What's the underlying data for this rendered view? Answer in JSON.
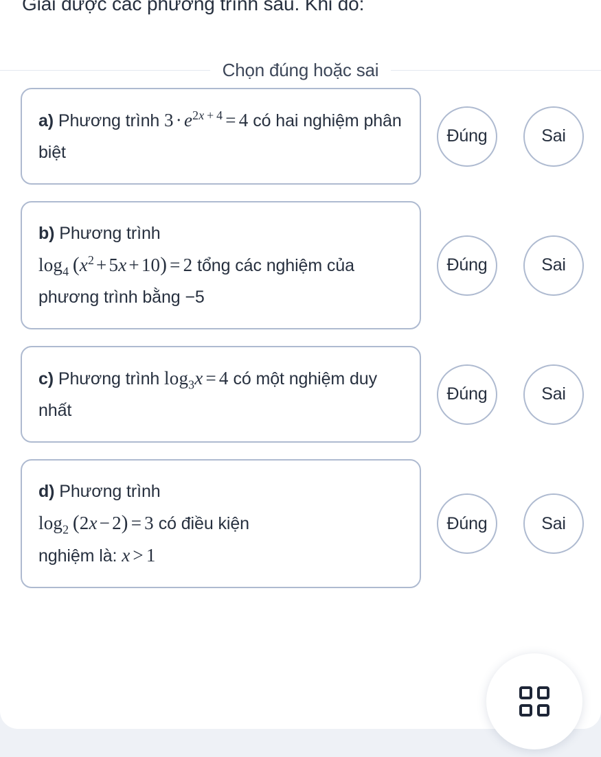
{
  "prompt": "Giải được các phương trình sau. Khi đó:",
  "section": {
    "label": "Chọn đúng hoặc sai"
  },
  "choices": {
    "true_label": "Đúng",
    "false_label": "Sai"
  },
  "questions": [
    {
      "marker": "a)",
      "lead": "Phương trình",
      "math": "3 · e^(2x + 4) = 4",
      "tail": "có hai nghiệm phân biệt",
      "full_text": "a) Phương trình 3 · e^(2x+4) = 4 có hai nghiệm phân biệt"
    },
    {
      "marker": "b)",
      "lead": "Phương trình",
      "math": "log_4 (x^2 + 5x + 10) = 2",
      "tail": "tổng các nghiệm của phương trình bằng −5",
      "full_text": "b) Phương trình log₄(x² + 5x + 10) = 2 tổng các nghiệm của phương trình bằng −5"
    },
    {
      "marker": "c)",
      "lead": "Phương trình",
      "math": "log_3 x = 4",
      "tail": "có một nghiệm duy nhất",
      "full_text": "c) Phương trình log₃x = 4 có một nghiệm duy nhất"
    },
    {
      "marker": "d)",
      "lead": "Phương trình",
      "math": "log_2 (2x − 2) = 3",
      "tail": "có điều kiện nghiệm là: x > 1",
      "full_text": "d) Phương trình log₂(2x − 2) = 3 có điều kiện nghiệm là: x > 1"
    }
  ],
  "floating_button": {
    "icon": "grid-4-icon"
  },
  "colors": {
    "text": "#27303f",
    "border": "#aebad0",
    "page_background": "#eef1f6",
    "card_background": "#ffffff",
    "divider": "#e3e8f0"
  }
}
